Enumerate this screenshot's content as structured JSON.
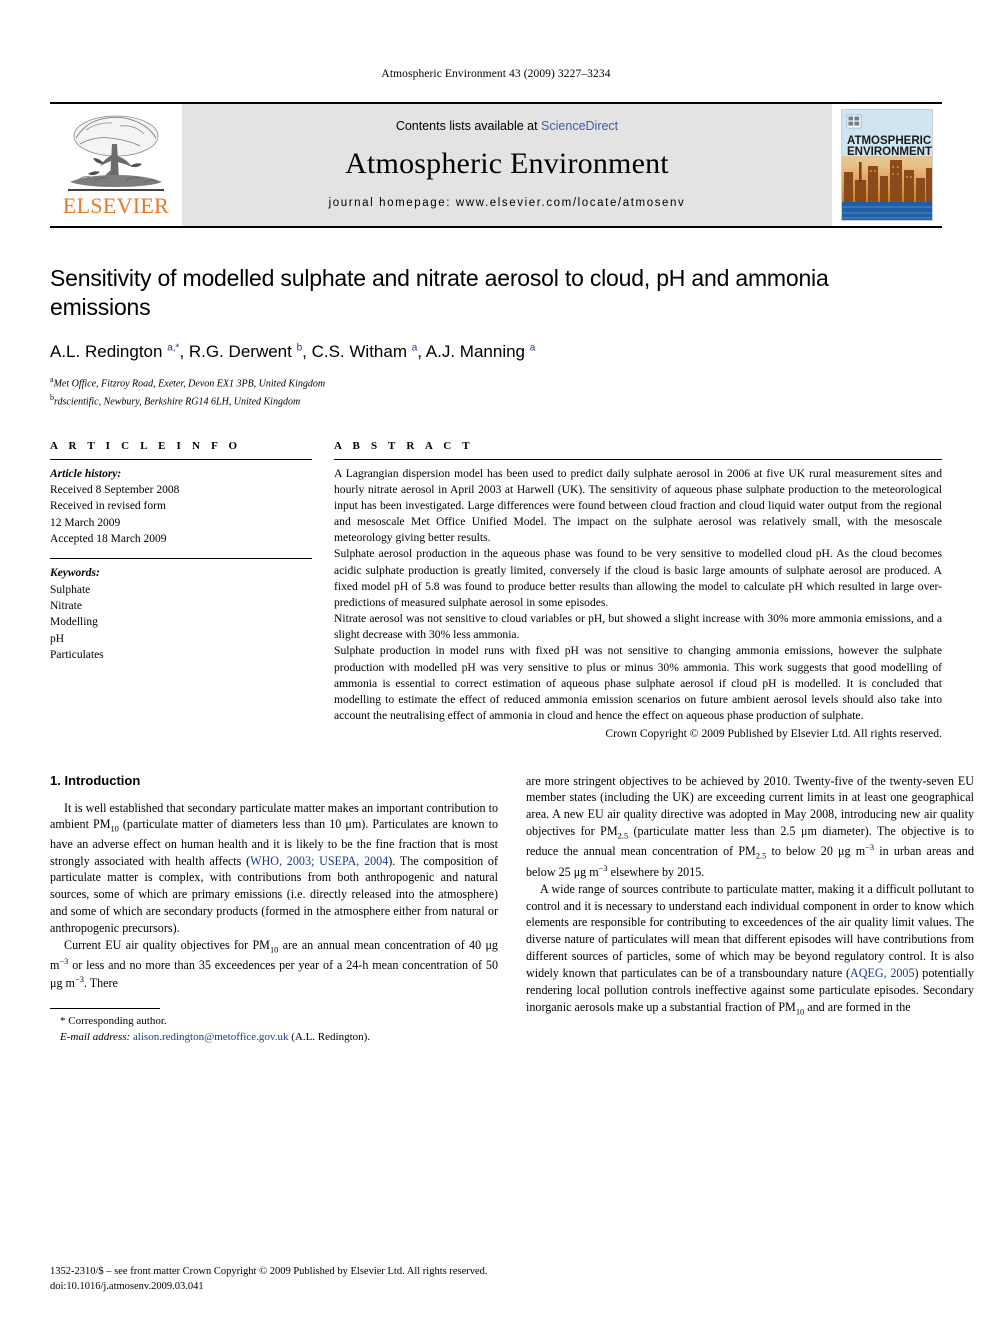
{
  "running_head": "Atmospheric Environment 43 (2009) 3227–3234",
  "masthead": {
    "publisher_name": "ELSEVIER",
    "contents_prefix": "Contents lists available at ",
    "contents_link": "ScienceDirect",
    "journal_title": "Atmospheric Environment",
    "homepage": "journal homepage: www.elsevier.com/locate/atmosenv",
    "cover_title_line1": "ATMOSPHERIC",
    "cover_title_line2": "ENVIRONMENT"
  },
  "article": {
    "title": "Sensitivity of modelled sulphate and nitrate aerosol to cloud, pH and ammonia emissions",
    "authors_html": "A.L. Redington <sup>a,*</sup>, R.G. Derwent <sup>b</sup>, C.S. Witham <sup>a</sup>, A.J. Manning <sup>a</sup>",
    "affiliation_a": "Met Office, Fitzroy Road, Exeter, Devon EX1 3PB, United Kingdom",
    "affiliation_b": "rdscientific, Newbury, Berkshire RG14 6LH, United Kingdom"
  },
  "article_info": {
    "heading": "A R T I C L E   I N F O",
    "history_label": "Article history:",
    "history": [
      "Received 8 September 2008",
      "Received in revised form",
      "12 March 2009",
      "Accepted 18 March 2009"
    ],
    "keywords_label": "Keywords:",
    "keywords": [
      "Sulphate",
      "Nitrate",
      "Modelling",
      "pH",
      "Particulates"
    ]
  },
  "abstract": {
    "heading": "A B S T R A C T",
    "paragraphs": [
      "A Lagrangian dispersion model has been used to predict daily sulphate aerosol in 2006 at five UK rural measurement sites and hourly nitrate aerosol in April 2003 at Harwell (UK). The sensitivity of aqueous phase sulphate production to the meteorological input has been investigated. Large differences were found between cloud fraction and cloud liquid water output from the regional and mesoscale Met Office Unified Model. The impact on the sulphate aerosol was relatively small, with the mesoscale meteorology giving better results.",
      "Sulphate aerosol production in the aqueous phase was found to be very sensitive to modelled cloud pH. As the cloud becomes acidic sulphate production is greatly limited, conversely if the cloud is basic large amounts of sulphate aerosol are produced. A fixed model pH of 5.8 was found to produce better results than allowing the model to calculate pH which resulted in large over-predictions of measured sulphate aerosol in some episodes.",
      "Nitrate aerosol was not sensitive to cloud variables or pH, but showed a slight increase with 30% more ammonia emissions, and a slight decrease with 30% less ammonia.",
      "Sulphate production in model runs with fixed pH was not sensitive to changing ammonia emissions, however the sulphate production with modelled pH was very sensitive to plus or minus 30% ammonia. This work suggests that good modelling of ammonia is essential to correct estimation of aqueous phase sulphate aerosol if cloud pH is modelled. It is concluded that modelling to estimate the effect of reduced ammonia emission scenarios on future ambient aerosol levels should also take into account the neutralising effect of ammonia in cloud and hence the effect on aqueous phase production of sulphate."
    ],
    "copyright": "Crown Copyright © 2009 Published by Elsevier Ltd. All rights reserved."
  },
  "body": {
    "section_number_title": "1.  Introduction",
    "left_paragraphs_html": [
      "It is well established that secondary particulate matter makes an important contribution to ambient PM<sub>10</sub> (particulate matter of diameters less than 10 &mu;m). Particulates are known to have an adverse effect on human health and it is likely to be the fine fraction that is most strongly associated with health affects (<span class=\"cite\">WHO, 2003; USEPA, 2004</span>). The composition of particulate matter is complex, with contributions from both anthropogenic and natural sources, some of which are primary emissions (i.e. directly released into the atmosphere) and some of which are secondary products (formed in the atmosphere either from natural or anthropogenic precursors).",
      "Current EU air quality objectives for PM<sub>10</sub> are an annual mean concentration of 40 &mu;g m<sup>&minus;3</sup> or less and no more than 35 exceedences per year of a 24-h mean concentration of 50 &mu;g m<sup>&minus;3</sup>. There"
    ],
    "right_paragraphs_html": [
      "are more stringent objectives to be achieved by 2010. Twenty-five of the twenty-seven EU member states (including the UK) are exceeding current limits in at least one geographical area. A new EU air quality directive was adopted in May 2008, introducing new air quality objectives for PM<sub>2.5</sub> (particulate matter less than 2.5 &mu;m diameter). The objective is to reduce the annual mean concentration of PM<sub>2.5</sub> to below 20 &mu;g m<sup>&minus;3</sup> in urban areas and below 25 &mu;g m<sup>&minus;3</sup> elsewhere by 2015.",
      "A wide range of sources contribute to particulate matter, making it a difficult pollutant to control and it is necessary to understand each individual component in order to know which elements are responsible for contributing to exceedences of the air quality limit values. The diverse nature of particulates will mean that different episodes will have contributions from different sources of particles, some of which may be beyond regulatory control. It is also widely known that particulates can be of a transboundary nature (<span class=\"cite\">AQEG, 2005</span>) potentially rendering local pollution controls ineffective against some particulate episodes. Secondary inorganic aerosols make up a substantial fraction of PM<sub>10</sub> and are formed in the"
    ]
  },
  "footnote": {
    "corresponding_author": "* Corresponding author.",
    "email_label": "E-mail address:",
    "email": "alison.redington@metoffice.gov.uk",
    "email_suffix": " (A.L. Redington)."
  },
  "page_footer": {
    "issn_line": "1352-2310/$ – see front matter Crown Copyright © 2009 Published by Elsevier Ltd. All rights reserved.",
    "doi_line": "doi:10.1016/j.atmosenv.2009.03.041"
  },
  "colors": {
    "elsevier_orange": "#E87722",
    "link_blue": "#1a3a8f",
    "band_grey": "#e3e3e3"
  }
}
